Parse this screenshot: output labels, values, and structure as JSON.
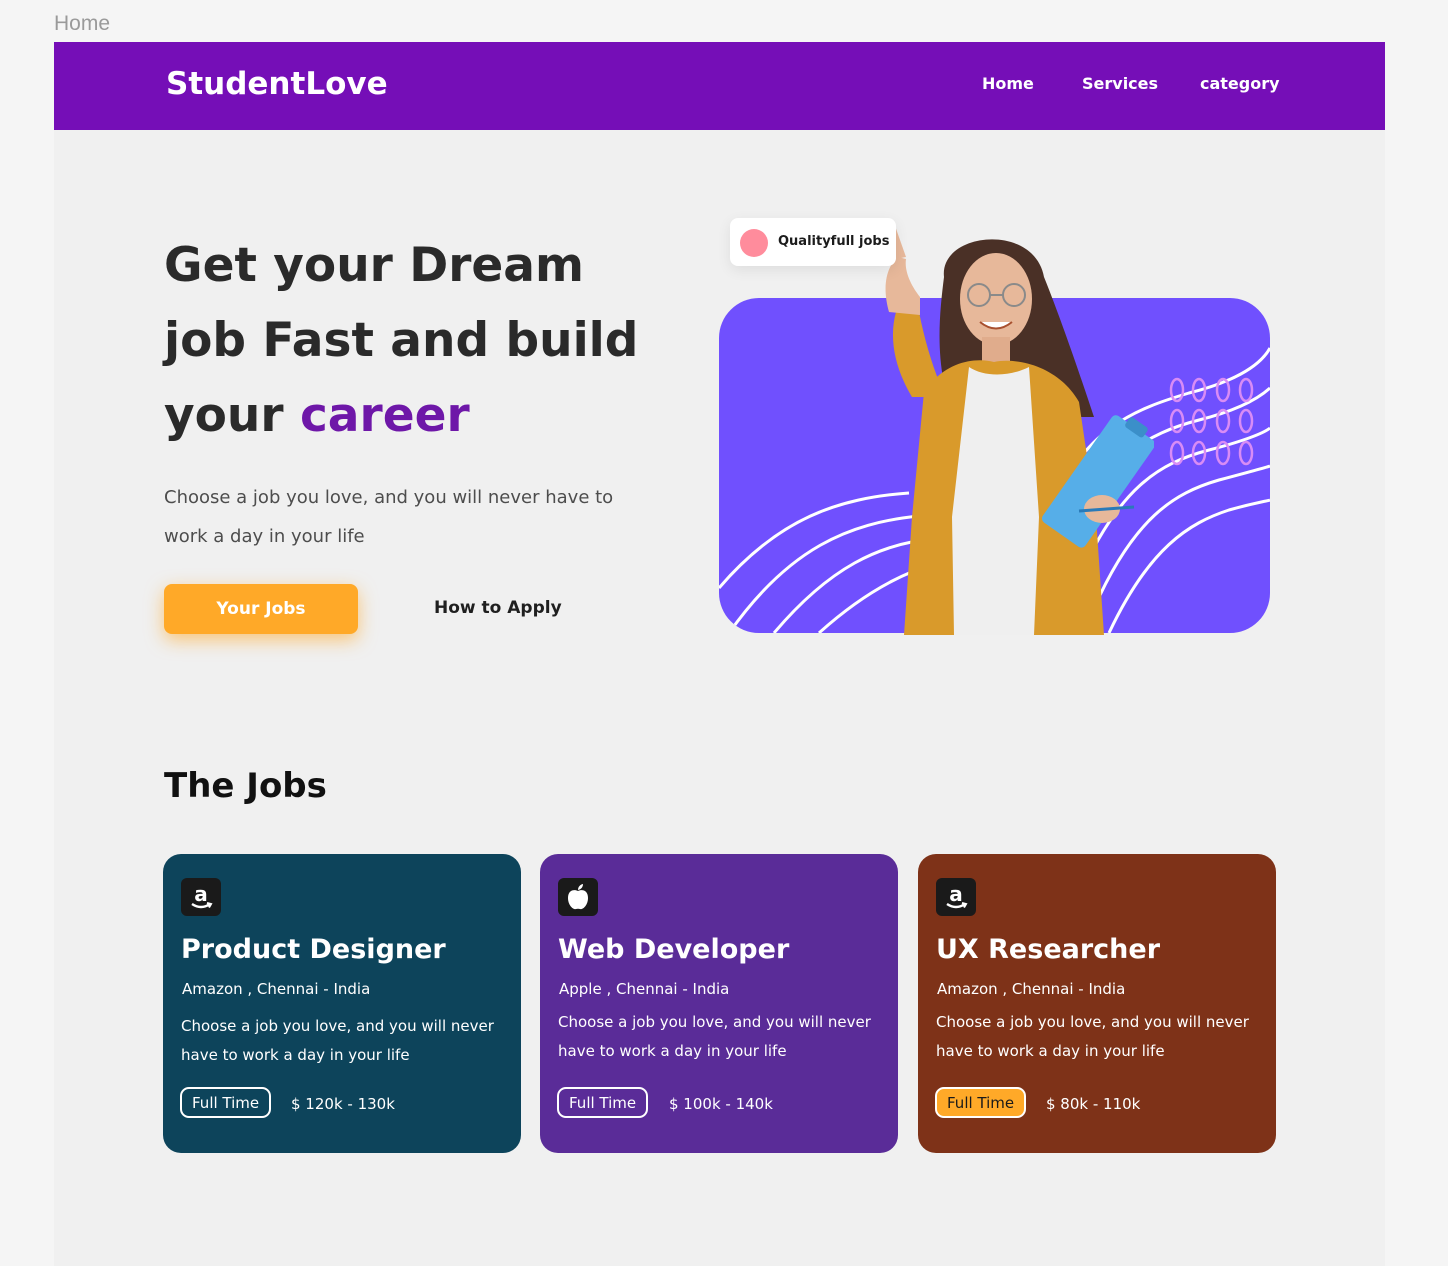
{
  "frame_label": "Home",
  "nav": {
    "brand": "StudentLove",
    "links": [
      "Home",
      "Services",
      "category"
    ]
  },
  "hero": {
    "title_line1": "Get your Dream",
    "title_line2": "job Fast and build",
    "title_line3_prefix": "your ",
    "title_accent": "career",
    "subtitle": "Choose a job you love, and you will never have to work a day in your life",
    "primary_button": "Your Jobs",
    "secondary_button": "How to Apply",
    "badge": "Qualityfull jobs"
  },
  "jobs_section": {
    "title": "The Jobs",
    "cards": [
      {
        "logo": "amazon-logo-icon",
        "title": "Product Designer",
        "company": "Amazon , Chennai - India",
        "description": "Choose a job you love, and you will never have to work a day in your life",
        "tag": "Full Time",
        "salary": "$ 120k - 130k",
        "bg": "#0d445b"
      },
      {
        "logo": "apple-logo-icon",
        "title": "Web Developer",
        "company": "Apple , Chennai - India",
        "description": "Choose a job you love, and you will never have to work a day in your life",
        "tag": "Full Time",
        "salary": "$ 100k - 140k",
        "bg": "#5a2c98"
      },
      {
        "logo": "amazon-logo-icon",
        "title": "UX Researcher",
        "company": "Amazon , Chennai - India",
        "description": "Choose a job you love, and you will never have to work a day in your life",
        "tag": "Full Time",
        "salary": "$ 80k - 110k",
        "bg": "#7e3218"
      }
    ]
  },
  "colors": {
    "nav_bg": "#750eb7",
    "accent_purple": "#6e17a8",
    "hero_card": "#7050fe",
    "primary_button": "#ffa928",
    "badge_dot": "#ff8c9c"
  }
}
